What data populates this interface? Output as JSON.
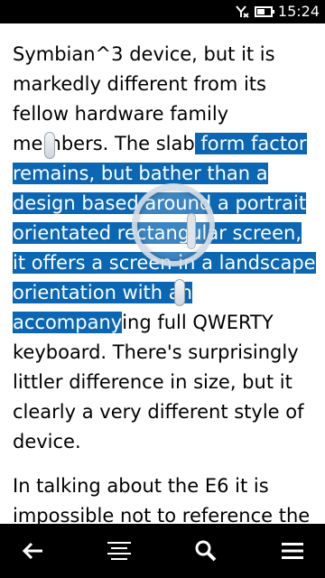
{
  "status": {
    "time": "15:24",
    "battery_level": 0.6,
    "icons": [
      "no-signal-icon",
      "battery-icon"
    ]
  },
  "document": {
    "paragraph1": {
      "before": "Symbian^3 device, but it is markedly different from its fellow hardware family members. The slab",
      "selected": " form factor remains, but bather than a design based around a portrait orientated rectangular screen, it offers a screen in a landscape orientation with an accompany",
      "after": "ing full QWERTY keyboard. There's surprisingly littler difference in size, but it clearly a very different style of device."
    },
    "paragraph2": "In talking about the E6 it is impossible not to reference the"
  },
  "toolbar": {
    "icons": [
      "back-arrow-icon",
      "text-align-icon",
      "search-icon",
      "menu-icon"
    ]
  },
  "colors": {
    "selection": "#0b67b3",
    "bars": "#000000"
  }
}
